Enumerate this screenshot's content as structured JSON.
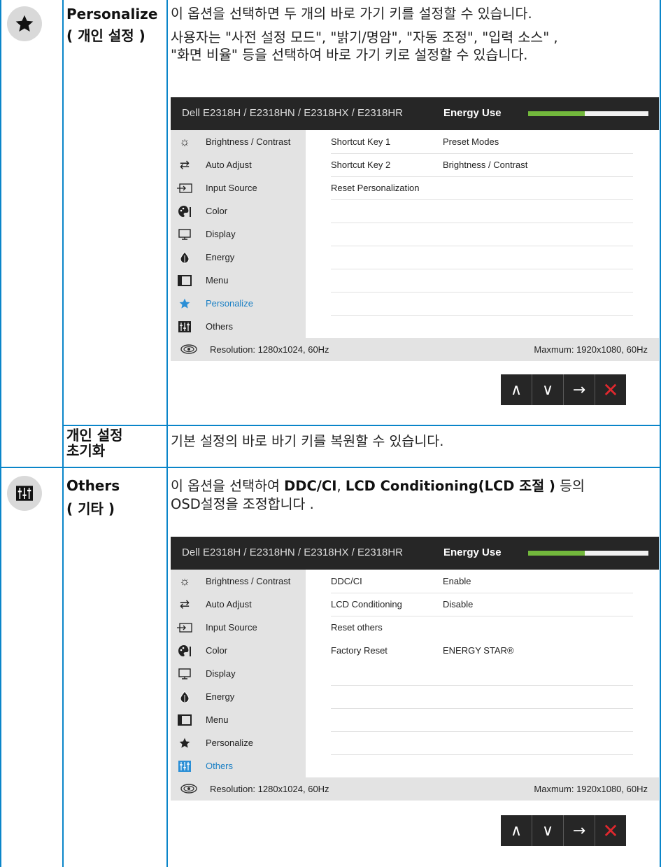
{
  "section_personalize": {
    "name_line1": "Personalize",
    "name_line2": "( 개인 설정 )",
    "desc1": "이 옵션을 선택하면 두 개의 바로 가기 키를 설정할 수 있습니다.",
    "desc2_line1": "사용자는 \"사전 설정 모드\", \"밝기/명암\", \"자동 조정\", \"입력 소스\" ,",
    "desc2_line2": "\"화면 비율\" 등을 선택하여 바로 가기 키로 설정할 수 있습니다."
  },
  "section_reset": {
    "name_line1": "개인 설정",
    "name_line2": "초기화",
    "desc": "기본 설정의 바로 바기 키를 복원할 수 있습니다."
  },
  "section_others": {
    "name_line1": "Others",
    "name_line2": "( 기타 )",
    "desc_line1_a": "이 옵션을 선택하여 ",
    "desc_line1_b": "DDC/CI",
    "desc_line1_c": ", ",
    "desc_line1_d": "LCD Conditioning(LCD 조절 )",
    "desc_line1_e": " 등의",
    "desc_line2": "OSD설정을 조정합니다 ."
  },
  "osd": {
    "title": "Dell E2318H / E2318HN / E2318HX / E2318HR",
    "energy_label": "Energy Use",
    "energy_level_percent": 47,
    "menu": [
      "Brightness / Contrast",
      "Auto Adjust",
      "Input Source",
      "Color",
      "Display",
      "Energy",
      "Menu",
      "Personalize",
      "Others"
    ],
    "resolution": "Resolution: 1280x1024, 60Hz",
    "maximum": "Maxmum: 1920x1080, 60Hz",
    "nav": {
      "up": "∧",
      "down": "∨",
      "enter": "→",
      "close": "✕"
    }
  },
  "osd_personalize": {
    "rows": [
      {
        "key": "Shortcut Key 1",
        "value": "Preset Modes"
      },
      {
        "key": "Shortcut Key 2",
        "value": "Brightness / Contrast"
      },
      {
        "key": "Reset Personalization",
        "value": ""
      }
    ]
  },
  "osd_others": {
    "rows": [
      {
        "key": "DDC/CI",
        "value": "Enable"
      },
      {
        "key": "LCD Conditioning",
        "value": "Disable"
      },
      {
        "key": "Reset others",
        "value": ""
      },
      {
        "key": "Factory Reset",
        "value": "ENERGY STAR®"
      }
    ]
  },
  "colors": {
    "rule_blue": "#0a85c9",
    "osd_header": "#262626",
    "energy_green": "#72b83c",
    "active_blue": "#2b8fd6",
    "close_red": "#e0282e"
  }
}
